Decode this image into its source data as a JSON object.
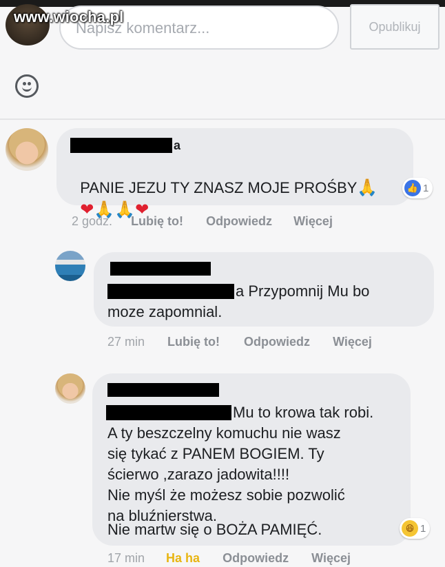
{
  "watermark": "www.wiocha.pl",
  "composer": {
    "placeholder": "Napisz komentarz...",
    "publish_label": "Opublikuj"
  },
  "comments": [
    {
      "author_suffix": "a",
      "text_line1": "PANIE JEZU TY ZNASZ MOJE PROŚBY",
      "reaction_count": "1",
      "time": "2 godz.",
      "like_label": "Lubię to!",
      "reply_label": "Odpowiedz",
      "more_label": "Więcej"
    },
    {
      "text_line1_tail": "a Przypomnij Mu bo",
      "text_line2": "moze zapomnial.",
      "time": "27 min",
      "like_label": "Lubię to!",
      "reply_label": "Odpowiedz",
      "more_label": "Więcej"
    },
    {
      "text_line1_tail": "Mu to krowa tak robi.",
      "text_lines": [
        "A ty beszczelny komuchu nie wasz",
        "się tykać z PANEM BOGIEM. Ty",
        "ścierwo ,zarazo jadowita!!!!",
        "Nie myśl że możesz sobie pozwolić",
        "na bluźnierstwa.",
        "Nie martw się o BOŻA PAMIĘĆ."
      ],
      "reaction_count": "1",
      "time": "17 min",
      "reaction_label": "Ha ha",
      "reply_label": "Odpowiedz",
      "more_label": "Więcej"
    }
  ],
  "colors": {
    "bubble": "#e9eaed",
    "like_blue": "#3b74e6",
    "haha_yellow": "#e8b512",
    "heart_red": "#e0202f"
  }
}
